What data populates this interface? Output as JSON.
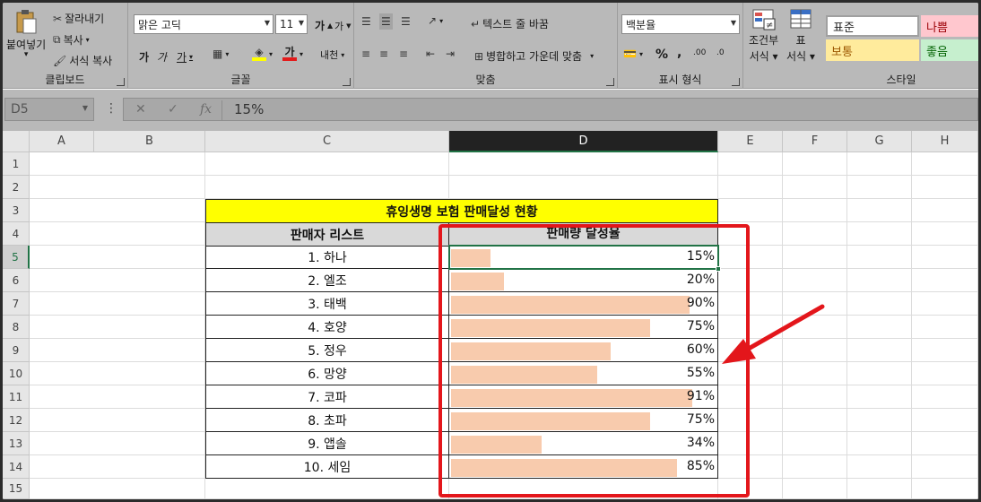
{
  "ribbon": {
    "clipboard": {
      "paste_label_1": "붙여넣기",
      "paste_label_2": "▾",
      "cut": "잘라내기",
      "copy": "복사",
      "format_painter": "서식 복사",
      "group_label": "클립보드"
    },
    "font": {
      "font_name": "맑은 고딕",
      "font_size": "11",
      "grow_label": "가",
      "shrink_label": "가",
      "bold": "가",
      "italic": "가",
      "underline": "가",
      "font_color_letter": "가",
      "phonetic_label": "내천",
      "group_label": "글꼴"
    },
    "alignment": {
      "wrap_text": "텍스트 줄 바꿈",
      "merge_center": "병합하고 가운데 맞춤",
      "group_label": "맞춤"
    },
    "number": {
      "format": "백분율",
      "percent": "%",
      "comma": ",",
      "increase_decimal": ".00",
      "decrease_decimal": ".0",
      "group_label": "표시 형식"
    },
    "styles": {
      "conditional_1": "조건부",
      "conditional_2": "서식 ▾",
      "table_1": "표",
      "table_2": "서식 ▾",
      "normal": "표준",
      "bad": "나쁨",
      "neutral": "보통",
      "good": "좋음",
      "group_label": "스타일",
      "colors": {
        "normal_bg": "#ffffff",
        "bad_bg": "#ffc7ce",
        "bad_fg": "#9c0006",
        "neutral_bg": "#ffeb9c",
        "neutral_fg": "#9c5700",
        "good_bg": "#c6efce",
        "good_fg": "#006100"
      }
    }
  },
  "formula_bar": {
    "name_box": "D5",
    "cancel": "✕",
    "enter": "✓",
    "fx": "fx",
    "value": "15%"
  },
  "grid": {
    "columns": [
      "A",
      "B",
      "C",
      "D",
      "E",
      "F",
      "G",
      "H"
    ],
    "active_column": "D",
    "rows": [
      "1",
      "2",
      "3",
      "4",
      "5",
      "6",
      "7",
      "8",
      "9",
      "10",
      "11",
      "12",
      "13",
      "14",
      "15"
    ],
    "active_row": "5",
    "table_title": "휴잉생명 보험 판매달성 현황",
    "header_seller": "판매자 리스트",
    "header_rate": "판매량 달성율",
    "sellers": [
      {
        "name": "1. 하나",
        "rate": "15%",
        "value": 0.15
      },
      {
        "name": "2. 엘조",
        "rate": "20%",
        "value": 0.2
      },
      {
        "name": "3. 태백",
        "rate": "90%",
        "value": 0.9
      },
      {
        "name": "4. 호양",
        "rate": "75%",
        "value": 0.75
      },
      {
        "name": "5. 정우",
        "rate": "60%",
        "value": 0.6
      },
      {
        "name": "6. 망양",
        "rate": "55%",
        "value": 0.55
      },
      {
        "name": "7. 코파",
        "rate": "91%",
        "value": 0.91
      },
      {
        "name": "8. 초파",
        "rate": "75%",
        "value": 0.75
      },
      {
        "name": "9. 앱솔",
        "rate": "34%",
        "value": 0.34
      },
      {
        "name": "10. 세임",
        "rate": "85%",
        "value": 0.85
      }
    ],
    "data_bar_color": "#f8cbad",
    "annotation_color": "#e3161b"
  }
}
